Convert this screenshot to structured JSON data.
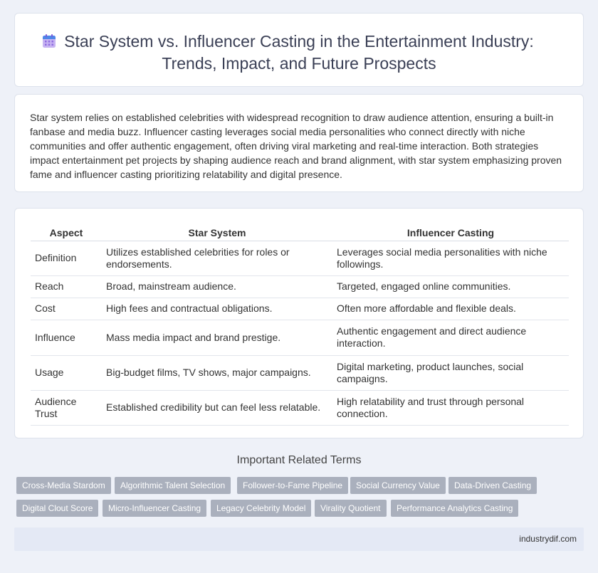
{
  "header": {
    "title_line1": "Star System vs. Influencer Casting in the Entertainment Industry:",
    "title_line2": "Trends, Impact, and Future Prospects",
    "icon": "calendar-icon",
    "accent": "#a16ae8"
  },
  "intro": {
    "text": "Star system relies on established celebrities with widespread recognition to draw audience attention, ensuring a built-in fanbase and media buzz. Influencer casting leverages social media personalities who connect directly with niche communities and offer authentic engagement, often driving viral marketing and real-time interaction. Both strategies impact entertainment pet projects by shaping audience reach and brand alignment, with star system emphasizing proven fame and influencer casting prioritizing relatability and digital presence."
  },
  "table": {
    "headers": [
      "Aspect",
      "Star System",
      "Influencer Casting"
    ],
    "rows": [
      [
        "Definition",
        "Utilizes established celebrities for roles or endorsements.",
        "Leverages social media personalities with niche followings."
      ],
      [
        "Reach",
        "Broad, mainstream audience.",
        "Targeted, engaged online communities."
      ],
      [
        "Cost",
        "High fees and contractual obligations.",
        "Often more affordable and flexible deals."
      ],
      [
        "Influence",
        "Mass media impact and brand prestige.",
        "Authentic engagement and direct audience interaction."
      ],
      [
        "Usage",
        "Big-budget films, TV shows, major campaigns.",
        "Digital marketing, product launches, social campaigns."
      ],
      [
        "Audience Trust",
        "Established credibility but can feel less relatable.",
        "High relatability and trust through personal connection."
      ]
    ]
  },
  "related": {
    "title": "Important Related Terms",
    "tags": [
      "Cross-Media Stardom",
      "Algorithmic Talent Selection",
      "Follower-to-Fame Pipeline",
      "Social Currency Value",
      "Data-Driven Casting",
      "Digital Clout Score",
      "Micro-Influencer Casting",
      "Legacy Celebrity Model",
      "Virality Quotient",
      "Performance Analytics Casting"
    ]
  },
  "footer": {
    "site": "industrydif.com"
  }
}
